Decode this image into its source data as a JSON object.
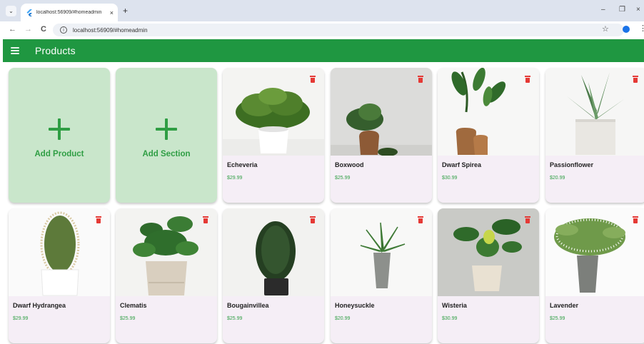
{
  "browser": {
    "tab_title": "localhost:56909/#homeadmin",
    "tab_close": "×",
    "new_tab": "+",
    "url": "localhost:56909/#homeadmin",
    "back": "←",
    "forward": "→",
    "reload": "C",
    "info": "ⓘ",
    "star": "☆",
    "menu": "⋮",
    "tab_search": "⌄",
    "window_minimize": "–",
    "window_restore": "❐",
    "window_close": "×"
  },
  "appbar": {
    "title": "Products"
  },
  "add_cards": [
    {
      "label": "Add Product"
    },
    {
      "label": "Add Section"
    }
  ],
  "products": [
    {
      "name": "Echeveria",
      "price": "$29.99"
    },
    {
      "name": "Boxwood",
      "price": "$25.99"
    },
    {
      "name": "Dwarf Spirea",
      "price": "$30.99"
    },
    {
      "name": "Passionflower",
      "price": "$20.99"
    },
    {
      "name": "Dwarf Hydrangea",
      "price": "$29.99"
    },
    {
      "name": "Clematis",
      "price": "$25.99"
    },
    {
      "name": "Bougainvillea",
      "price": "$25.99"
    },
    {
      "name": "Honeysuckle",
      "price": "$20.99"
    },
    {
      "name": "Wisteria",
      "price": "$30.99"
    },
    {
      "name": "Lavender",
      "price": "$25.99"
    }
  ],
  "colors": {
    "primary": "#1f9741",
    "add_card_bg": "#c9e6cb",
    "accent_green": "#2f9e44",
    "delete_red": "#e53935",
    "card_bg": "#f5eef6"
  }
}
